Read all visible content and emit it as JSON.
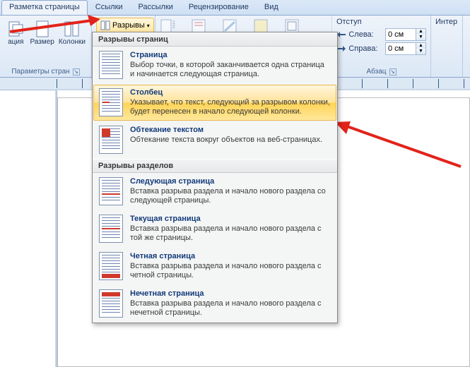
{
  "tabs": {
    "page_layout": "Разметка страницы",
    "references": "Ссылки",
    "mailings": "Рассылки",
    "review": "Рецензирование",
    "view": "Вид"
  },
  "ribbon": {
    "orientation": "ация",
    "size": "Размер",
    "columns": "Колонки",
    "breaks": "Разрывы",
    "page_setup_caption": "Параметры стран",
    "indent_label": "Отступ",
    "indent_left_label": "Слева:",
    "indent_right_label": "Справа:",
    "indent_left_value": "0 см",
    "indent_right_value": "0 см",
    "interval_label": "Интер",
    "paragraph_caption": "Абзац"
  },
  "dropdown": {
    "header_page": "Разрывы страниц",
    "header_section": "Разрывы разделов",
    "items_page": [
      {
        "title": "Страница",
        "desc": "Выбор точки, в которой заканчивается одна страница и начинается следующая страница."
      },
      {
        "title": "Столбец",
        "desc": "Указывает, что текст, следующий за разрывом колонки, будет перенесен в начало следующей колонки."
      },
      {
        "title": "Обтекание текстом",
        "desc": "Обтекание текста вокруг объектов на веб-страницах."
      }
    ],
    "items_section": [
      {
        "title": "Следующая страница",
        "desc": "Вставка разрыва раздела и начало нового раздела со следующей страницы."
      },
      {
        "title": "Текущая страница",
        "desc": "Вставка разрыва раздела и начало нового раздела с той же страницы."
      },
      {
        "title": "Четная страница",
        "desc": "Вставка разрыва раздела и начало нового раздела с четной страницы."
      },
      {
        "title": "Нечетная страница",
        "desc": "Вставка разрыва раздела и начало нового раздела с нечетной страницы."
      }
    ]
  }
}
